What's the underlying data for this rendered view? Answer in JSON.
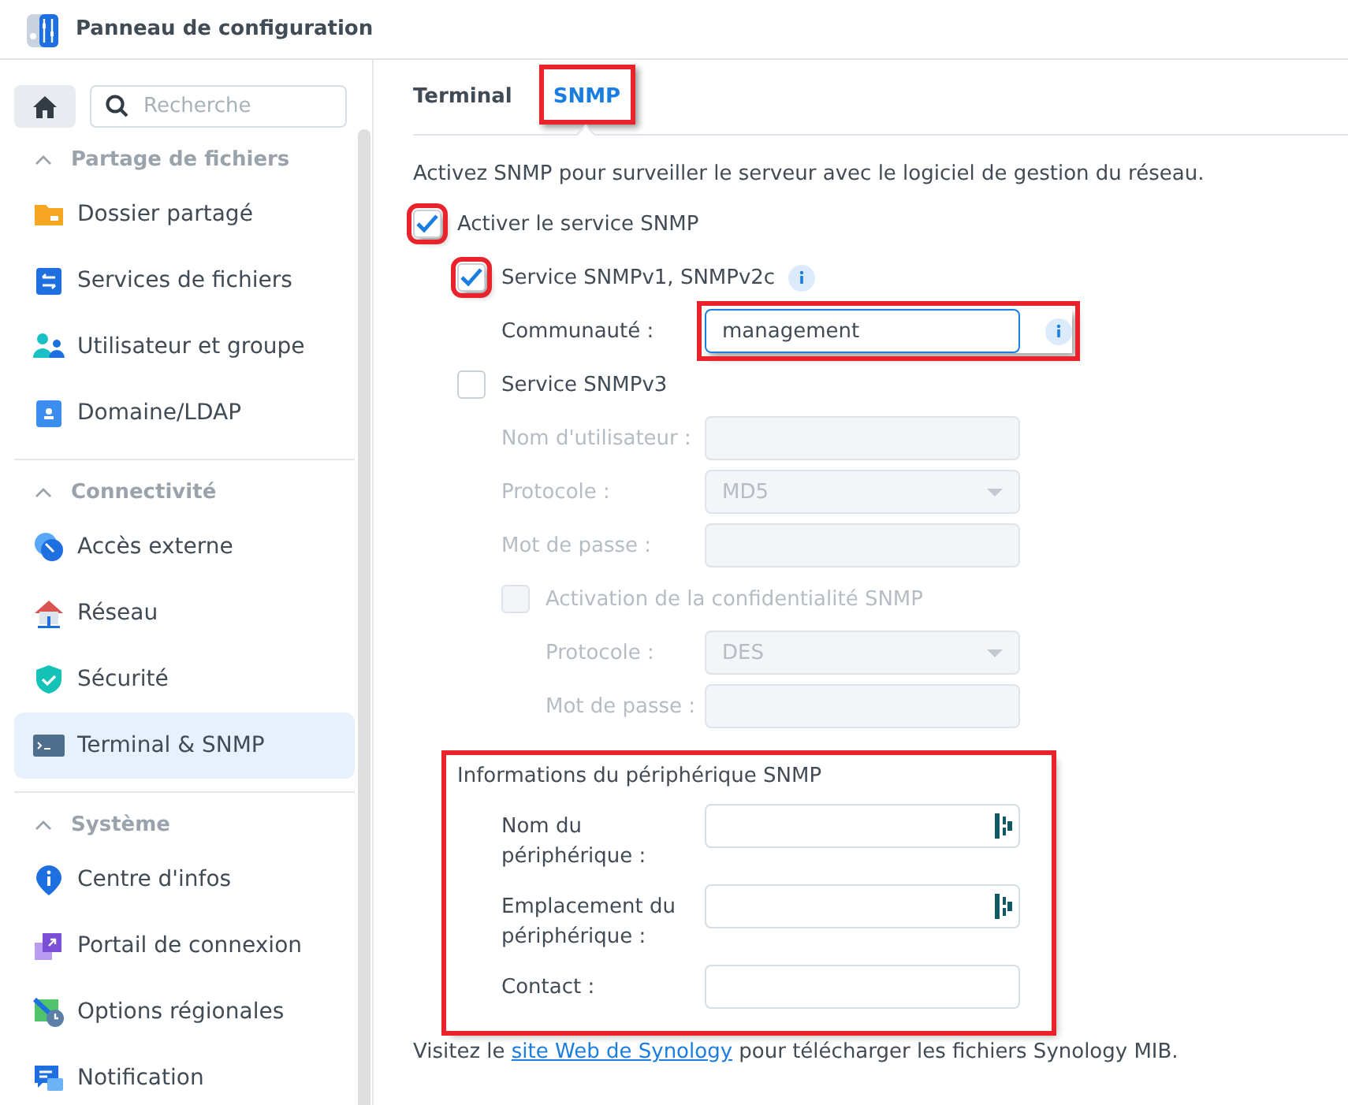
{
  "window": {
    "title": "Panneau de configuration"
  },
  "sidebar": {
    "search": {
      "placeholder": "Recherche"
    },
    "groups": [
      {
        "title": "Partage de fichiers",
        "expanded": true,
        "items": [
          {
            "label": "Dossier partagé",
            "selected": false
          },
          {
            "label": "Services de fichiers",
            "selected": false
          },
          {
            "label": "Utilisateur et groupe",
            "selected": false
          },
          {
            "label": "Domaine/LDAP",
            "selected": false
          }
        ]
      },
      {
        "title": "Connectivité",
        "expanded": true,
        "items": [
          {
            "label": "Accès externe",
            "selected": false
          },
          {
            "label": "Réseau",
            "selected": false
          },
          {
            "label": "Sécurité",
            "selected": false
          },
          {
            "label": "Terminal & SNMP",
            "selected": true
          }
        ]
      },
      {
        "title": "Système",
        "expanded": true,
        "items": [
          {
            "label": "Centre d'infos",
            "selected": false
          },
          {
            "label": "Portail de connexion",
            "selected": false
          },
          {
            "label": "Options régionales",
            "selected": false
          },
          {
            "label": "Notification",
            "selected": false
          }
        ]
      }
    ]
  },
  "tabs": [
    {
      "label": "Terminal",
      "selected": false,
      "highlighted": false
    },
    {
      "label": "SNMP",
      "selected": true,
      "highlighted": true
    }
  ],
  "description": "Activez SNMP pour surveiller le serveur avec le logiciel de gestion du réseau.",
  "form": [
    {
      "kind": "checkbox",
      "label": "Activer le service SNMP",
      "checked": true,
      "disabled": false,
      "highlighted": true,
      "info": false,
      "children": [
        {
          "kind": "checkbox",
          "label": "Service SNMPv1, SNMPv2c",
          "checked": true,
          "disabled": false,
          "highlighted": true,
          "info": true,
          "children": [
            {
              "kind": "text",
              "label": "Communauté :",
              "value": "management",
              "disabled": false,
              "focused": true,
              "highlighted": true,
              "info": true
            }
          ]
        },
        {
          "kind": "checkbox",
          "label": "Service SNMPv3",
          "checked": false,
          "disabled": false,
          "highlighted": false,
          "info": false,
          "children": [
            {
              "kind": "text",
              "label": "Nom d'utilisateur :",
              "disabled": true,
              "focused": false,
              "highlighted": false,
              "info": false
            },
            {
              "kind": "select",
              "label": "Protocole :",
              "value": "MD5",
              "disabled": true
            },
            {
              "kind": "text",
              "label": "Mot de passe :",
              "disabled": true,
              "focused": false,
              "highlighted": false,
              "info": false
            },
            {
              "kind": "checkbox",
              "label": "Activation de la confidentialité SNMP",
              "checked": false,
              "disabled": true,
              "highlighted": false,
              "info": false,
              "children": [
                {
                  "kind": "select",
                  "label": "Protocole :",
                  "value": "DES",
                  "disabled": true
                },
                {
                  "kind": "text",
                  "label": "Mot de passe :",
                  "disabled": true,
                  "focused": false,
                  "highlighted": false,
                  "info": false
                }
              ]
            }
          ]
        }
      ]
    }
  ],
  "device_info": {
    "title": "Informations du périphérique SNMP",
    "highlighted": true,
    "fields": [
      {
        "label": "Nom du périphérique :",
        "autofill": true
      },
      {
        "label": "Emplacement du périphérique :",
        "autofill": true
      },
      {
        "label": "Contact :",
        "autofill": false
      }
    ]
  },
  "footer": {
    "before": "Visitez le ",
    "link": "site Web de Synology",
    "after": " pour télécharger les fichiers Synology MIB."
  }
}
